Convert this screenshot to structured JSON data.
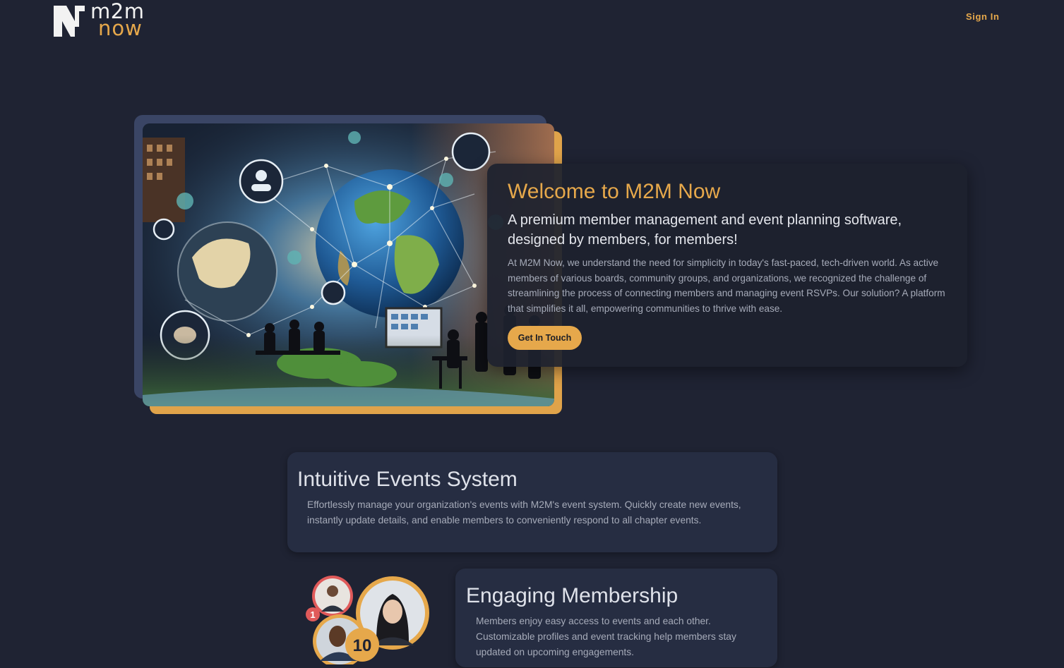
{
  "header": {
    "logo_line1": "m2m",
    "logo_line2": "now",
    "signin_label": "Sign In"
  },
  "hero": {
    "title": "Welcome to M2M Now",
    "subtitle": "A premium member management and event planning software, designed by members, for members!",
    "body": "At M2M Now, we understand the need for simplicity in today's fast-paced, tech-driven world. As active members of various boards, community groups, and organizations, we recognized the challenge of streamlining the process of connecting members and managing event RSVPs. Our solution? A platform that simplifies it all, empowering communities to thrive with ease.",
    "cta_label": "Get In Touch",
    "image_icon": "globe-network-illustration"
  },
  "features": [
    {
      "title": "Intuitive Events System",
      "body": "Effortlessly manage your organization's events with M2M's event system. Quickly create new events, instantly update details, and enable members to conveniently respond to all chapter events."
    },
    {
      "title": "Engaging Membership",
      "body": "Members enjoy easy access to events and each other. Customizable profiles and event tracking help members stay updated on upcoming engagements."
    }
  ],
  "membership_badges": {
    "badge_small": "1",
    "badge_large": "10"
  },
  "colors": {
    "background": "#1f2333",
    "accent": "#e6a84b",
    "card": "#262d42",
    "hero_card": "#1d212e"
  }
}
